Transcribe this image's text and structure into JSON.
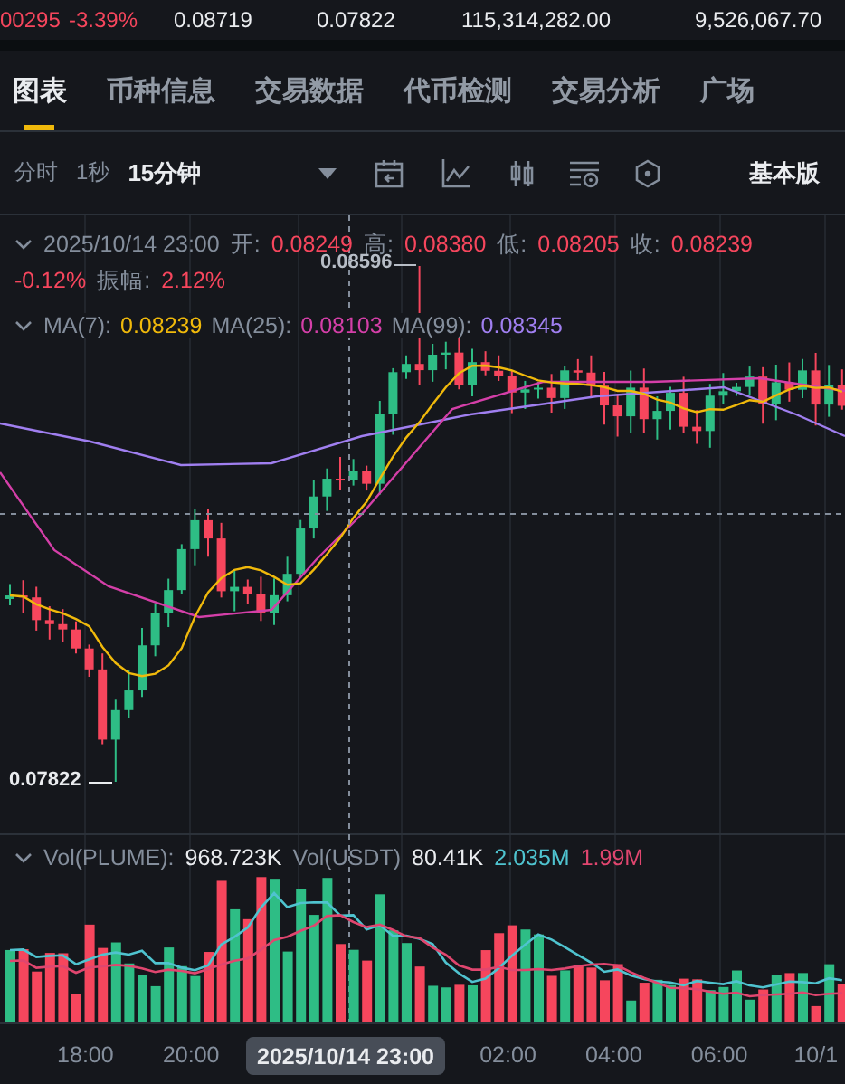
{
  "ticker": [
    {
      "text": "00295",
      "kind": "down"
    },
    {
      "text": "-3.39%",
      "kind": "down"
    },
    {
      "text": "0.08719",
      "kind": "plain"
    },
    {
      "text": "0.07822",
      "kind": "plain"
    },
    {
      "text": "115,314,282.00",
      "kind": "plain"
    },
    {
      "text": "9,526,067.70",
      "kind": "plain"
    }
  ],
  "tabs": [
    {
      "label": "图表",
      "selected": true
    },
    {
      "label": "币种信息",
      "selected": false
    },
    {
      "label": "交易数据",
      "selected": false
    },
    {
      "label": "代币检测",
      "selected": false
    },
    {
      "label": "交易分析",
      "selected": false
    },
    {
      "label": "广场",
      "selected": false
    }
  ],
  "intervals": [
    {
      "label": "分时",
      "selected": false
    },
    {
      "label": "1秒",
      "selected": false
    },
    {
      "label": "15分钟",
      "selected": true
    }
  ],
  "mode_button": "基本版",
  "candle_info": {
    "time": "2025/10/14 23:00",
    "kind": "down",
    "fields": [
      {
        "label": "开:",
        "value": "0.08249"
      },
      {
        "label": "高:",
        "value": "0.08380"
      },
      {
        "label": "低:",
        "value": "0.08205"
      },
      {
        "label": "收:",
        "value": "0.08239"
      }
    ],
    "change": "-0.12%",
    "amplitude_label": "振幅:",
    "amplitude": "2.12%"
  },
  "moving_averages": [
    {
      "label": "MA(7):",
      "value": "0.08239",
      "color": "#f0b90b"
    },
    {
      "label": "MA(25):",
      "value": "0.08103",
      "color": "#d43fa8"
    },
    {
      "label": "MA(99):",
      "value": "0.08345",
      "color": "#a07ff0"
    }
  ],
  "price_markers": {
    "high": "0.08596",
    "low": "0.07822"
  },
  "volume": [
    {
      "label": "Vol(PLUME):",
      "value": "968.723K",
      "color": "#eaecef"
    },
    {
      "label": "Vol(USDT)",
      "value": "80.41K",
      "color": "#eaecef"
    },
    {
      "value": "2.035M",
      "color": "#4fc3cf"
    },
    {
      "value": "1.99M",
      "color": "#e0466f"
    }
  ],
  "time_axis": {
    "labels": [
      "18:00",
      "20:00",
      "02:00",
      "04:00",
      "06:00",
      "10/1"
    ],
    "crosshair": "2025/10/14 23:00"
  }
}
